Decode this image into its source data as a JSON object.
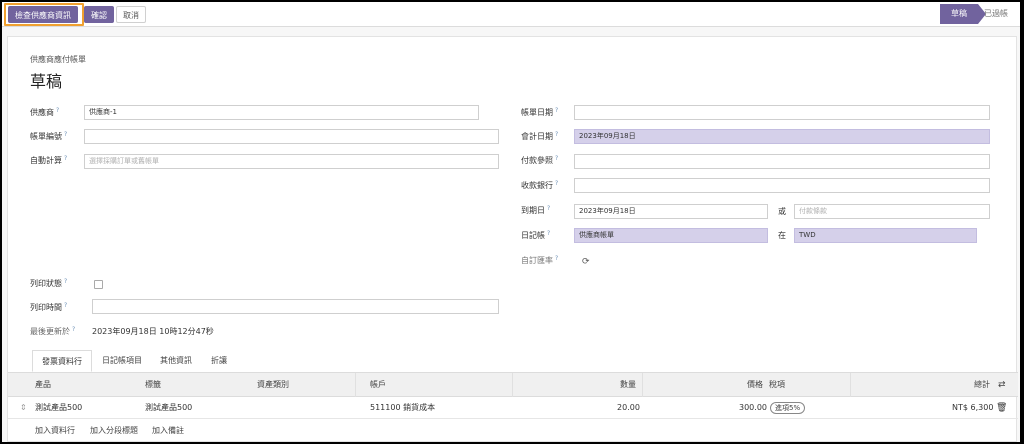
{
  "toolbar": {
    "check_vendor_label": "檢查供應商資訊",
    "confirm_label": "確認",
    "cancel_label": "取消"
  },
  "status": {
    "active": "草稿",
    "next": "已過帳"
  },
  "form": {
    "subtitle": "供應商應付帳單",
    "title": "草稿",
    "left": {
      "vendor_label": "供應商",
      "vendor_value": "供應商-1",
      "bill_ref_label": "帳單編號",
      "bill_ref_value": "",
      "auto_complete_label": "自動計算",
      "auto_complete_placeholder": "選擇採購訂單或舊帳單"
    },
    "right": {
      "bill_date_label": "帳單日期",
      "bill_date_value": "",
      "accounting_date_label": "會計日期",
      "accounting_date_value": "2023年09月18日",
      "payment_ref_label": "付款參照",
      "payment_ref_value": "",
      "bank_label": "收款銀行",
      "bank_value": "",
      "due_date_label": "到期日",
      "due_date_value": "2023年09月18日",
      "or_label": "或",
      "terms_placeholder": "付款條款",
      "journal_label": "日記帳",
      "journal_value": "供應商帳單",
      "in_label": "在",
      "currency_value": "TWD",
      "rate_label": "自訂匯率"
    },
    "print": {
      "print_status_label": "列印狀態",
      "print_time_label": "列印時間",
      "print_time_value": "",
      "last_update_label": "最後更新於",
      "last_update_value": "2023年09月18日 10時12分47秒"
    }
  },
  "tabs": [
    "發票資料行",
    "日記帳項目",
    "其他資訊",
    "折讓"
  ],
  "table": {
    "headers": {
      "product": "產品",
      "label": "標籤",
      "asset_type": "資產類別",
      "account": "帳戶",
      "quantity": "數量",
      "price": "價格",
      "taxes": "稅項",
      "subtotal": "總計"
    },
    "rows": [
      {
        "product": "測試產品500",
        "label": "測試產品500",
        "asset_type": "",
        "account": "511100 銷貨成本",
        "quantity": "20.00",
        "price": "300.00",
        "taxes": "進項5%",
        "subtotal": "NT$ 6,300"
      }
    ],
    "add_line": "加入資料行",
    "add_section": "加入分段標題",
    "add_note": "加入備註"
  },
  "colors": {
    "primary": "#71639e",
    "required_field": "#d5d0ea",
    "highlight": "#f0a030"
  }
}
